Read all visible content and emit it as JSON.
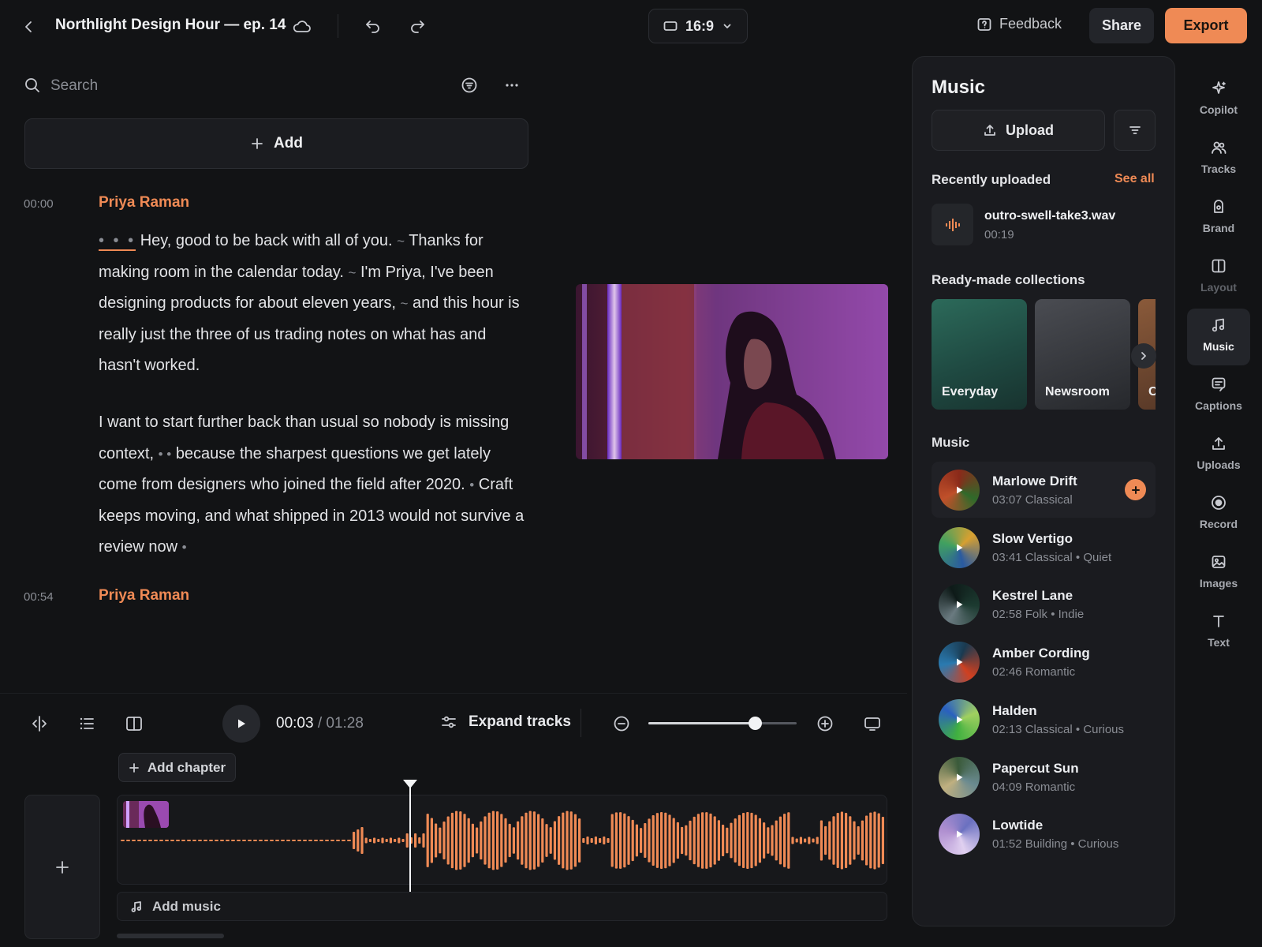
{
  "header": {
    "project_title": "Northlight Design Hour — ep. 14",
    "aspect_ratio": "16:9",
    "feedback_label": "Feedback",
    "share_label": "Share",
    "export_label": "Export"
  },
  "script": {
    "search_placeholder": "Search",
    "add_label": "Add",
    "blocks": [
      {
        "timestamp": "00:00",
        "speaker": "Priya Raman",
        "paragraphs": [
          {
            "pre": "• • •",
            "s1": "Hey, good to be back with all of you.",
            "p1": "~",
            "s2": "Thanks for making room in the calendar today.",
            "p2": "~",
            "s3": "I'm Priya, I've been designing products for about eleven years,",
            "p3": "~",
            "s4": "and this hour is really just the three of us trading notes on what has and hasn't worked."
          },
          {
            "s1": "I want to start further back than usual so nobody is missing context,",
            "p1": "• •",
            "s2": "because the sharpest questions we get lately come from designers who joined the field after 2020.",
            "p2": "•",
            "s3": "Craft keeps moving, and what shipped in 2013 would not survive a review now",
            "p3": "•"
          }
        ]
      },
      {
        "timestamp": "00:54",
        "speaker": "Priya Raman"
      }
    ]
  },
  "timeline": {
    "current_time": "00:03",
    "separator": "/",
    "total_time": "01:28",
    "expand_tracks_label": "Expand tracks",
    "zoom_level": 0.72,
    "playhead_fraction": 0.038,
    "add_chapter_label": "Add chapter",
    "add_music_label": "Add music"
  },
  "music_panel": {
    "title": "Music",
    "upload_label": "Upload",
    "recent_title": "Recently uploaded",
    "see_all_label": "See all",
    "recent_file": {
      "name": "outro-swell-take3.wav",
      "duration": "00:19"
    },
    "collections_title": "Ready-made collections",
    "collections": [
      {
        "label": "Everyday"
      },
      {
        "label": "Newsroom"
      },
      {
        "label": "C"
      }
    ],
    "tracks_title": "Music",
    "tracks": [
      {
        "name": "Marlowe Drift",
        "duration": "03:07",
        "meta": "Classical",
        "selected": true
      },
      {
        "name": "Slow Vertigo",
        "duration": "03:41",
        "meta": "Classical • Quiet"
      },
      {
        "name": "Kestrel Lane",
        "duration": "02:58",
        "meta": "Folk • Indie"
      },
      {
        "name": "Amber Cording",
        "duration": "02:46",
        "meta": "Romantic"
      },
      {
        "name": "Halden",
        "duration": "02:13",
        "meta": "Classical • Curious"
      },
      {
        "name": "Papercut Sun",
        "duration": "04:09",
        "meta": "Romantic"
      },
      {
        "name": "Lowtide",
        "duration": "01:52",
        "meta": "Building • Curious"
      }
    ]
  },
  "rail": [
    {
      "label": "Copilot",
      "icon": "sparkle-icon"
    },
    {
      "label": "Tracks",
      "icon": "people-icon"
    },
    {
      "label": "Brand",
      "icon": "brand-icon"
    },
    {
      "label": "Layout",
      "icon": "layout-icon",
      "disabled": true
    },
    {
      "label": "Music",
      "icon": "music-note-icon",
      "active": true
    },
    {
      "label": "Captions",
      "icon": "captions-icon"
    },
    {
      "label": "Uploads",
      "icon": "upload-icon"
    },
    {
      "label": "Record",
      "icon": "record-icon"
    },
    {
      "label": "Images",
      "icon": "image-icon"
    },
    {
      "label": "Text",
      "icon": "text-icon"
    }
  ],
  "colors": {
    "accent": "#ef8a55",
    "background": "#121315",
    "panel": "#1a1b1f"
  }
}
